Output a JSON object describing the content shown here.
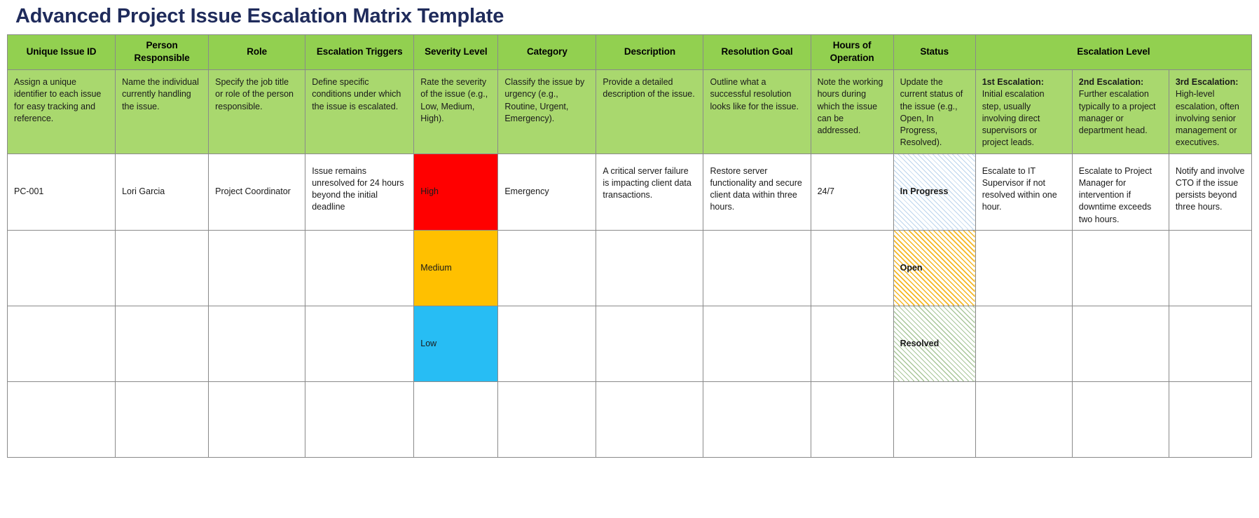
{
  "page_title": "Advanced Project Issue Escalation Matrix Template",
  "colors": {
    "title": "#1F2B5B",
    "header_green": "#92D050",
    "guide_green": "#A9D86E",
    "severity_high": "#FF0000",
    "severity_medium": "#FFC000",
    "severity_low": "#27BDF4",
    "status_inprogress_hatch": "#BBD4EC",
    "status_open_hatch": "#F5B723",
    "status_resolved_hatch": "#A9C79A",
    "grid_line": "#8A8A8A"
  },
  "table": {
    "group_header": {
      "label": "Escalation Level",
      "span": 3
    },
    "headers": [
      "Unique Issue ID",
      "Person Responsible",
      "Role",
      "Escalation Triggers",
      "Severity Level",
      "Category",
      "Description",
      "Resolution Goal",
      "Hours of Operation",
      "Status"
    ],
    "escalation_headers": [
      "1st Escalation",
      "2nd Escalation",
      "3rd Escalation"
    ],
    "guidance": [
      "Assign a unique identifier to each issue for easy tracking and reference.",
      "Name the individual currently handling the issue.",
      "Specify the job title or role of the person responsible.",
      "Define specific conditions under which the issue is escalated.",
      "Rate the severity of the issue (e.g., Low, Medium, High).",
      "Classify the issue by urgency (e.g., Routine, Urgent, Emergency).",
      "Provide a detailed description of the issue.",
      "Outline what a successful resolution looks like for the issue.",
      "Note the working hours during which the issue can be addressed.",
      "Update the current status of the issue (e.g., Open, In Progress, Resolved)."
    ],
    "guidance_escalation": [
      {
        "bold": "1st Escalation:",
        "text": "Initial escalation step, usually involving direct supervisors or project leads."
      },
      {
        "bold": "2nd Escalation:",
        "text": "Further escalation typically to a project manager or department head."
      },
      {
        "bold": "3rd Escalation:",
        "text": "High-level escalation, often involving senior management or executives."
      }
    ],
    "rows": [
      {
        "unique_issue_id": "PC-001",
        "person_responsible": "Lori Garcia",
        "role": "Project Coordinator",
        "escalation_triggers": "Issue remains unresolved for 24 hours beyond the initial deadline",
        "severity_level": "High",
        "category": "Emergency",
        "description": "A critical server failure is impacting client data transactions.",
        "resolution_goal": "Restore server functionality and secure client data within three hours.",
        "hours_of_operation": "24/7",
        "status": "In Progress",
        "escalation_1": "Escalate to IT Supervisor if not resolved within one hour.",
        "escalation_2": "Escalate to Project Manager for intervention if downtime exceeds two hours.",
        "escalation_3": "Notify and involve CTO if the issue persists beyond three hours."
      },
      {
        "unique_issue_id": "",
        "person_responsible": "",
        "role": "",
        "escalation_triggers": "",
        "severity_level": "Medium",
        "category": "",
        "description": "",
        "resolution_goal": "",
        "hours_of_operation": "",
        "status": "Open",
        "escalation_1": "",
        "escalation_2": "",
        "escalation_3": ""
      },
      {
        "unique_issue_id": "",
        "person_responsible": "",
        "role": "",
        "escalation_triggers": "",
        "severity_level": "Low",
        "category": "",
        "description": "",
        "resolution_goal": "",
        "hours_of_operation": "",
        "status": "Resolved",
        "escalation_1": "",
        "escalation_2": "",
        "escalation_3": ""
      },
      {
        "unique_issue_id": "",
        "person_responsible": "",
        "role": "",
        "escalation_triggers": "",
        "severity_level": "",
        "category": "",
        "description": "",
        "resolution_goal": "",
        "hours_of_operation": "",
        "status": "",
        "escalation_1": "",
        "escalation_2": "",
        "escalation_3": ""
      }
    ]
  }
}
